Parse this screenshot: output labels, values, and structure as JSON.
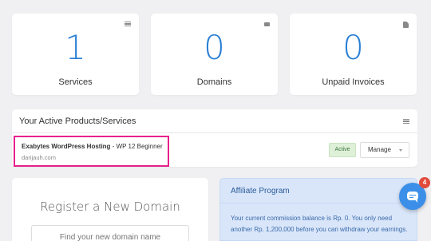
{
  "stats": [
    {
      "value": "1",
      "label": "Services",
      "icon": "cube-icon"
    },
    {
      "value": "0",
      "label": "Domains",
      "icon": "globe-icon"
    },
    {
      "value": "0",
      "label": "Unpaid Invoices",
      "icon": "document-icon"
    }
  ],
  "services_panel": {
    "title": "Your Active Products/Services",
    "product": {
      "name": "Exabytes WordPress Hosting",
      "plan": " - WP 12 Beginner",
      "domain": "darijauh.com",
      "status": "Active",
      "manage_label": "Manage"
    }
  },
  "register": {
    "title": "Register a New Domain",
    "search_placeholder": "Find your new domain name"
  },
  "affiliate": {
    "title": "Affiliate Program",
    "message": "Your current commission balance is Rp. 0. You only need another Rp. 1,200,000 before you can withdraw your earnings."
  },
  "chat": {
    "badge_count": "4"
  },
  "colors": {
    "accent": "#2a7fd4",
    "highlight_border": "#e6218b",
    "status_active_bg": "#dff0d8",
    "affiliate_bg": "#d9e6fa",
    "chat_button": "#3b8fe8",
    "chat_badge": "#e14b3b"
  }
}
